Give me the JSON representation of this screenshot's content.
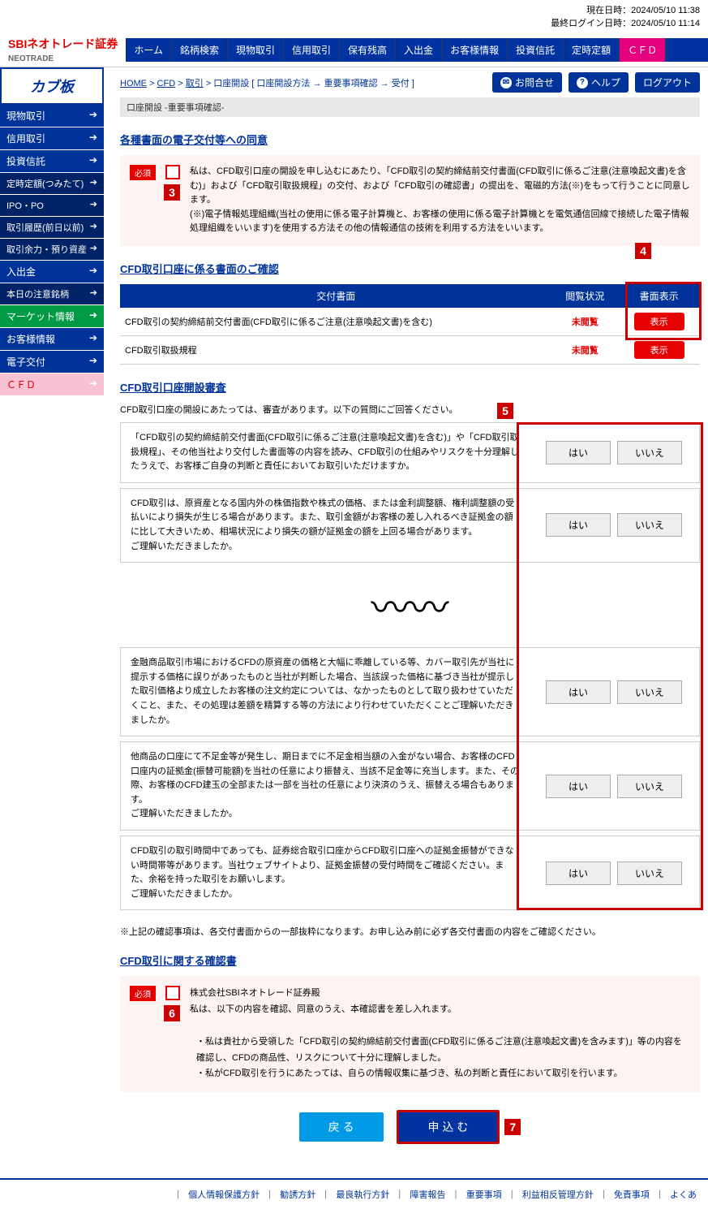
{
  "header": {
    "current_time_label": "現在日時：",
    "current_time": "2024/05/10 11:38",
    "last_login_label": "最終ログイン日時：",
    "last_login": "2024/05/10 11:14",
    "logo_main": "SBIネオトレード証券",
    "logo_sub": "NEOTRADE"
  },
  "top_nav": [
    "ホーム",
    "銘柄検索",
    "現物取引",
    "信用取引",
    "保有残高",
    "入出金",
    "お客様情報",
    "投資信託",
    "定時定額",
    "ＣＦＤ"
  ],
  "sidebar": {
    "kabu": "カブ板",
    "items": [
      {
        "label": "現物取引",
        "cls": ""
      },
      {
        "label": "信用取引",
        "cls": ""
      },
      {
        "label": "投資信託",
        "cls": ""
      },
      {
        "label": "定時定額(つみたて)",
        "cls": "dark"
      },
      {
        "label": "IPO・PO",
        "cls": "dark"
      },
      {
        "label": "取引履歴(前日以前)",
        "cls": "dark"
      },
      {
        "label": "取引余力・預り資産",
        "cls": "dark"
      },
      {
        "label": "入出金",
        "cls": ""
      },
      {
        "label": "本日の注意銘柄",
        "cls": "dark"
      },
      {
        "label": "マーケット情報",
        "cls": "green"
      },
      {
        "label": "お客様情報",
        "cls": ""
      },
      {
        "label": "電子交付",
        "cls": ""
      },
      {
        "label": "ＣＦＤ",
        "cls": "pink"
      }
    ]
  },
  "breadcrumb": {
    "parts": [
      "HOME",
      "CFD",
      "取引",
      "口座開設 [ 口座開設方法 → 重要事項確認 → 受付 ]"
    ],
    "contact": "お問合せ",
    "help": "ヘルプ",
    "logout": "ログアウト"
  },
  "page_title": "口座開設 -重要事項確認-",
  "consent1": {
    "heading": "各種書面の電子交付等への同意",
    "required": "必須",
    "text1": "私は、CFD取引口座の開設を申し込むにあたり、「CFD取引の契約締結前交付書面(CFD取引に係るご注意(注意喚起文書)を含む)」および「CFD取引取扱規程」の交付、および「CFD取引の確認書」の提出を、電磁的方法(※)をもって行うことに同意します。",
    "text2": "(※)電子情報処理組織(当社の使用に係る電子計算機と、お客様の使用に係る電子計算機とを電気通信回線で接続した電子情報処理組織をいいます)を使用する方法その他の情報通信の技術を利用する方法をいいます。"
  },
  "doc_section": {
    "heading": "CFD取引口座に係る書面のご確認",
    "cols": [
      "交付書面",
      "閲覧状況",
      "書面表示"
    ],
    "rows": [
      {
        "name": "CFD取引の契約締結前交付書面(CFD取引に係るご注意(注意喚起文書)を含む)",
        "status": "未閲覧",
        "btn": "表示"
      },
      {
        "name": "CFD取引取扱規程",
        "status": "未閲覧",
        "btn": "表示"
      }
    ]
  },
  "review": {
    "heading": "CFD取引口座開設審査",
    "lead": "CFD取引口座の開設にあたっては、審査があります。以下の質問にご回答ください。",
    "yes": "はい",
    "no": "いいえ",
    "questions_top": [
      "「CFD取引の契約締結前交付書面(CFD取引に係るご注意(注意喚起文書)を含む)」や「CFD取引取扱規程」、その他当社より交付した書面等の内容を読み、CFD取引の仕組みやリスクを十分理解したうえで、お客様ご自身の判断と責任においてお取引いただけますか。",
      "CFD取引は、原資産となる国内外の株価指数や株式の価格、または金利調整額、権利調整額の受払いにより損失が生じる場合があります。また、取引金額がお客様の差し入れるべき証拠金の額に比して大きいため、相場状況により損失の額が証拠金の額を上回る場合があります。\nご理解いただきましたか。"
    ],
    "questions_bottom": [
      "金融商品取引市場におけるCFDの原資産の価格と大幅に乖離している等、カバー取引先が当社に提示する価格に誤りがあったものと当社が判断した場合、当該誤った価格に基づき当社が提示した取引価格より成立したお客様の注文約定については、なかったものとして取り扱わせていただくこと、また、その処理は差額を精算する等の方法により行わせていただくことご理解いただきましたか。",
      "他商品の口座にて不足金等が発生し、期日までに不足金相当額の入金がない場合、お客様のCFD口座内の証拠金(振替可能額)を当社の任意により振替え、当該不足金等に充当します。また、その際、お客様のCFD建玉の全部または一部を当社の任意により決済のうえ、振替える場合もあります。\nご理解いただきましたか。",
      "CFD取引の取引時間中であっても、証券総合取引口座からCFD取引口座への証拠金振替ができない時間帯等があります。当社ウェブサイトより、証拠金振替の受付時間をご確認ください。また、余裕を持った取引をお願いします。\nご理解いただきましたか。"
    ]
  },
  "note": "※上記の確認事項は、各交付書面からの一部抜粋になります。お申し込み前に必ず各交付書面の内容をご確認ください。",
  "confirm": {
    "heading": "CFD取引に関する確認書",
    "required": "必須",
    "addressee": "株式会社SBIネオトレード証券殿",
    "line1": "私は、以下の内容を確認、同意のうえ、本確認書を差し入れます。",
    "bullet1": "・私は貴社から受領した「CFD取引の契約締結前交付書面(CFD取引に係るご注意(注意喚起文書)を含みます)」等の内容を確認し、CFDの商品性、リスクについて十分に理解しました。",
    "bullet2": "・私がCFD取引を行うにあたっては、自らの情報収集に基づき、私の判断と責任において取引を行います。"
  },
  "actions": {
    "back": "戻 る",
    "submit": "申 込 む"
  },
  "callouts": {
    "c3": "3",
    "c4": "4",
    "c5": "5",
    "c6": "6",
    "c7": "7"
  },
  "footer_links": [
    "個人情報保護方針",
    "勧誘方針",
    "最良執行方針",
    "障害報告",
    "重要事項",
    "利益相反管理方針",
    "免責事項",
    "よくあ"
  ]
}
